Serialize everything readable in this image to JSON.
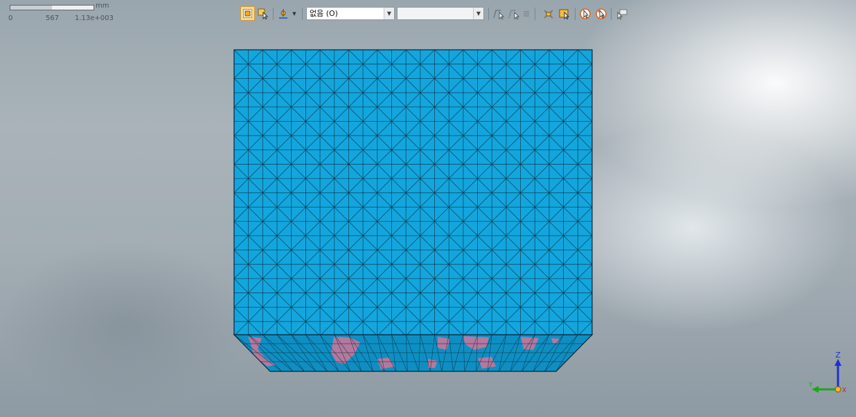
{
  "scale_bar": {
    "tick_start": "0",
    "tick_mid": "567",
    "tick_end": "1.13e+003",
    "unit": "mm"
  },
  "toolbar": {
    "buttons": [
      {
        "name": "box-select-icon",
        "active": true
      },
      {
        "name": "select-cursor-icon",
        "active": false
      },
      {
        "name": "pick-point-icon",
        "active": false
      },
      {
        "name": "filter-dropdown-icon",
        "active": false
      }
    ],
    "display_select_value": "없음 (O)",
    "secondary_select_value": ""
  },
  "model": {
    "face_color": "#13a6de",
    "bottom_color": "#0e8fc3",
    "mesh_line_color": "#0b2d3d",
    "highlight_color": "#c8759a"
  },
  "triad": {
    "z_label": "Z",
    "y_label": "Y",
    "x_label": "X"
  }
}
